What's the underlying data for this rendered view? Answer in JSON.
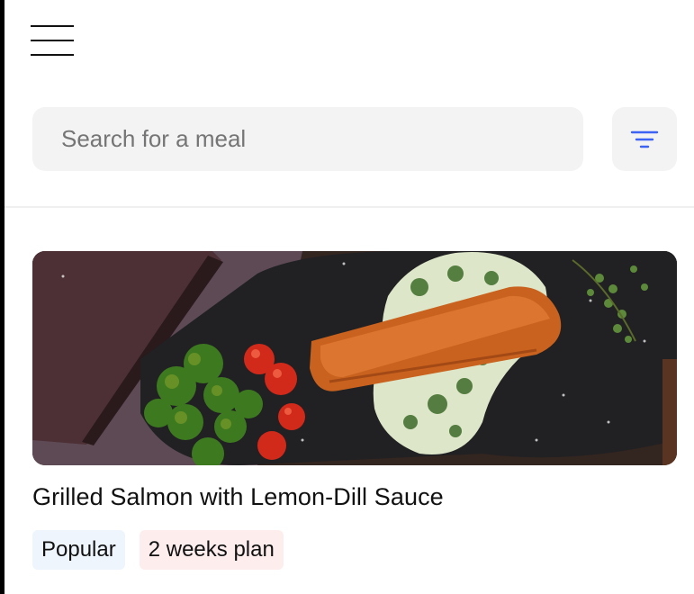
{
  "header": {
    "menu_icon": "hamburger-menu-icon"
  },
  "search": {
    "placeholder": "Search for a meal",
    "value": "",
    "filter_icon": "filter-icon",
    "accent_color": "#3d63f5"
  },
  "meals": [
    {
      "title": "Grilled Salmon with Lemon-Dill Sauce",
      "tags": [
        {
          "label": "Popular",
          "color": "#eef5fd"
        },
        {
          "label": "2 weeks plan",
          "color": "#fdeeed"
        }
      ]
    }
  ]
}
